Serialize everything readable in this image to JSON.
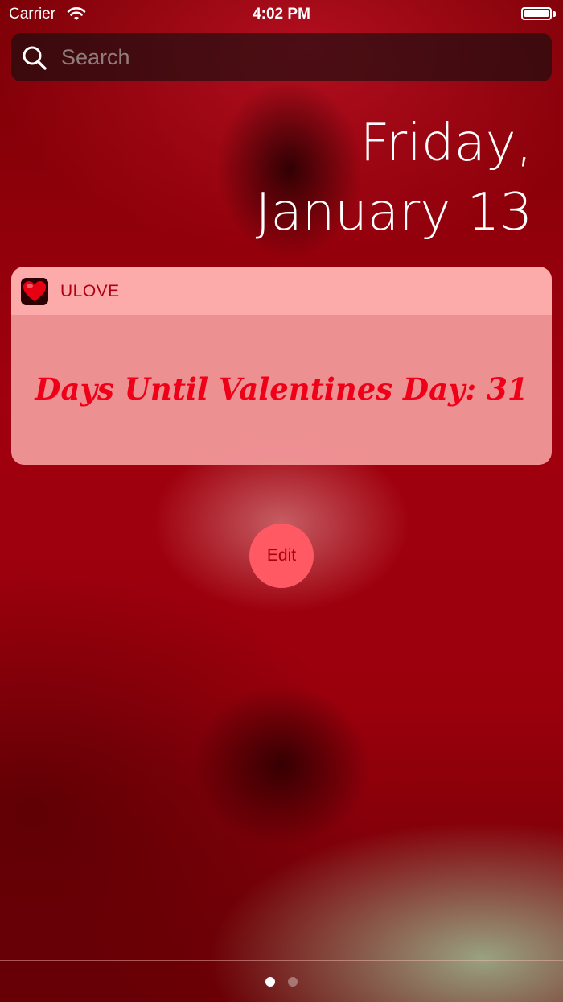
{
  "status_bar": {
    "carrier": "Carrier",
    "time": "4:02 PM",
    "wifi_icon": "wifi-icon",
    "battery_icon": "battery-icon"
  },
  "search": {
    "placeholder": "Search",
    "icon": "search-icon"
  },
  "date": {
    "weekday": "Friday,",
    "month_day": "January 13"
  },
  "widget": {
    "app_name": "ULOVE",
    "app_icon": "heart-icon",
    "countdown_text": "Days Until Valentines Day: 31",
    "accent_color": "#f00018"
  },
  "edit_button": {
    "label": "Edit"
  },
  "page_control": {
    "pages": 2,
    "current_page": 1
  }
}
